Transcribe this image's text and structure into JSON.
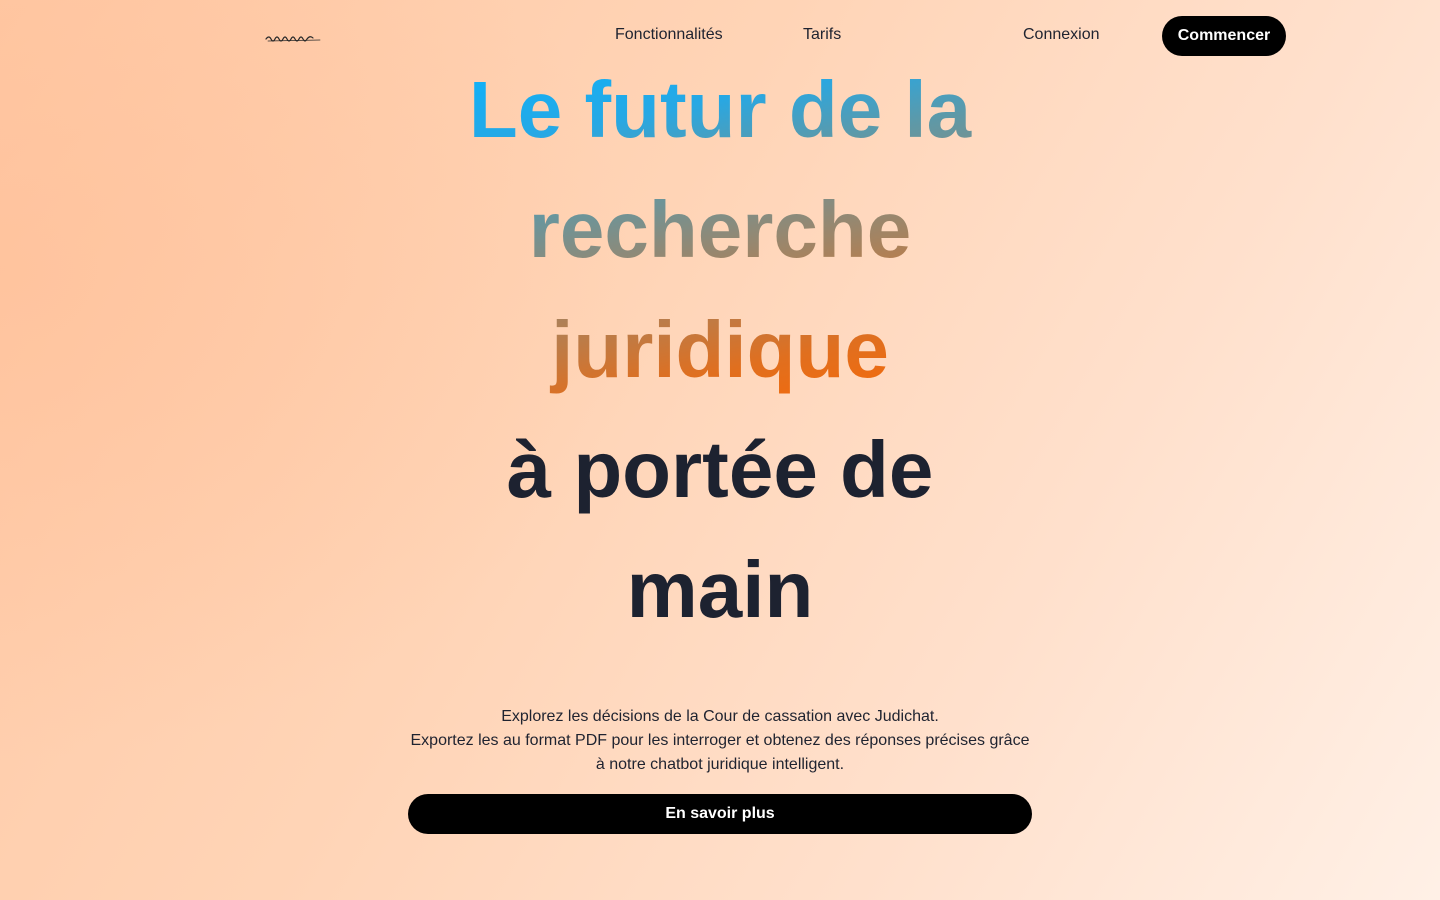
{
  "nav": {
    "logo_alt": "signature logo",
    "links": [
      {
        "label": "Fonctionnalités"
      },
      {
        "label": "Tarifs"
      },
      {
        "label": "Connexion"
      }
    ],
    "cta_label": "Commencer"
  },
  "hero": {
    "title_line1": "Le futur de la",
    "title_line2": "recherche",
    "title_line3": "juridique",
    "title_line4": "à portée de",
    "title_line5": "main"
  },
  "intro": {
    "line1": "Explorez les décisions de la Cour de cassation avec Judichat.",
    "line2": "Exportez les au format PDF pour les interroger et obtenez des réponses précises grâce à notre chatbot juridique intelligent."
  },
  "cta": {
    "learn_more_label": "En savoir plus"
  },
  "colors": {
    "gradient_start": "#0fb3f5",
    "gradient_end": "#ff6a00",
    "button_bg": "#000000",
    "text_dark": "#1d2230",
    "background_warm": "#ffd4b6"
  }
}
